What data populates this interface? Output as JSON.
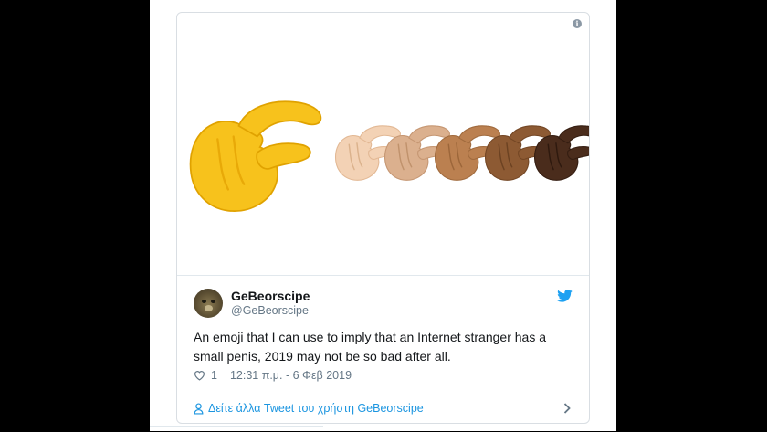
{
  "tweet": {
    "display_name": "GeBeorscipe",
    "handle": "@GeBeorscipe",
    "text": "An emoji that I can use to imply that an Internet stranger has a small penis, 2019 may not be so bad after all.",
    "like_count": "1",
    "timestamp": "12:31 π.μ. - 6 Φεβ 2019"
  },
  "footer": {
    "more_tweets_label": "Δείτε άλλα Tweet του χρήστη GeBeorscipe"
  },
  "icons": {
    "info": "info-icon",
    "bird": "twitter-bird-icon",
    "heart": "heart-icon",
    "user": "user-icon",
    "chevron": "chevron-right-icon"
  },
  "colors": {
    "link": "#1b95e0",
    "secondary": "#657786",
    "emoji_yellow": "#f7c21c",
    "skin_tones": [
      "#f3d2b5",
      "#dbb08e",
      "#bb8050",
      "#8d5a33",
      "#4a2c1c"
    ]
  }
}
